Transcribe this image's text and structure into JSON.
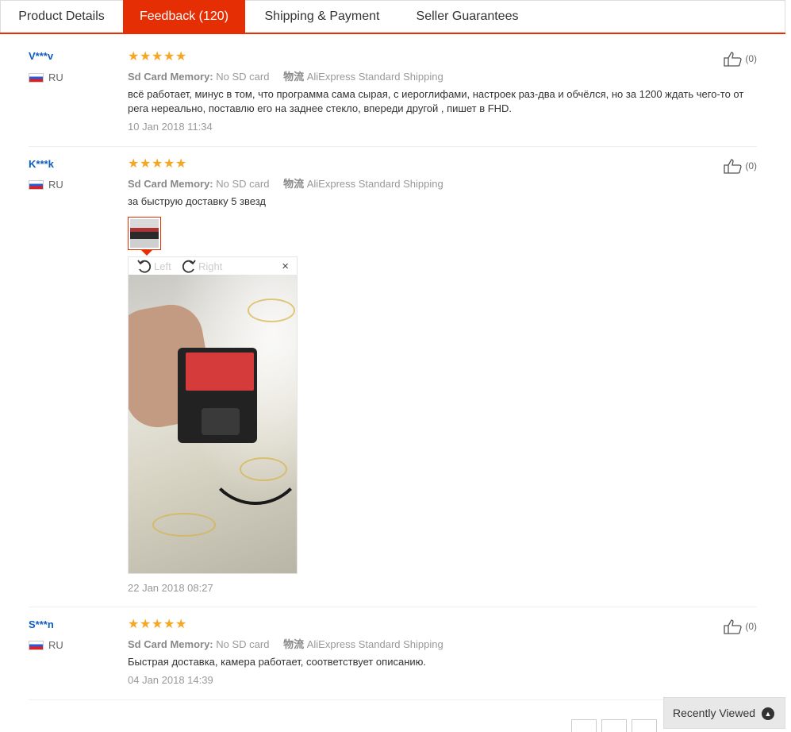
{
  "tabs": [
    {
      "label": "Product Details"
    },
    {
      "label": "Feedback (120)"
    },
    {
      "label": "Shipping & Payment"
    },
    {
      "label": "Seller Guarantees"
    }
  ],
  "feedback": [
    {
      "user": "V***v",
      "country": "RU",
      "rating": 5,
      "attr_key": "Sd Card Memory:",
      "attr_value": "No SD card",
      "shipping_key": "物流",
      "shipping_value": "AliExpress Standard Shipping",
      "text": "всё работает, минус в том, что программа сама сырая, с иероглифами, настроек раз-два и обчёлся, но за 1200 ждать чего-то от рега нереально, поставлю его на заднее стекло, впереди другой , пишет в FHD.",
      "date": "10 Jan 2018 11:34",
      "likes": "(0)"
    },
    {
      "user": "K***k",
      "country": "RU",
      "rating": 5,
      "attr_key": "Sd Card Memory:",
      "attr_value": "No SD card",
      "shipping_key": "物流",
      "shipping_value": "AliExpress Standard Shipping",
      "text": "за быструю доставку 5 звезд",
      "date": "22 Jan 2018 08:27",
      "likes": "(0)"
    },
    {
      "user": "S***n",
      "country": "RU",
      "rating": 5,
      "attr_key": "Sd Card Memory:",
      "attr_value": "No SD card",
      "shipping_key": "物流",
      "shipping_value": "AliExpress Standard Shipping",
      "text": "Быстрая доставка, камера работает, соответствует описанию.",
      "date": "04 Jan 2018 14:39",
      "likes": "(0)"
    }
  ],
  "viewer": {
    "rotate_left": "Left",
    "rotate_right": "Right",
    "close": "×"
  },
  "recently_viewed": {
    "label": "Recently Viewed"
  },
  "colors": {
    "accent": "#e62e04",
    "star": "#f5a623",
    "user_link": "#0d5ebf"
  }
}
